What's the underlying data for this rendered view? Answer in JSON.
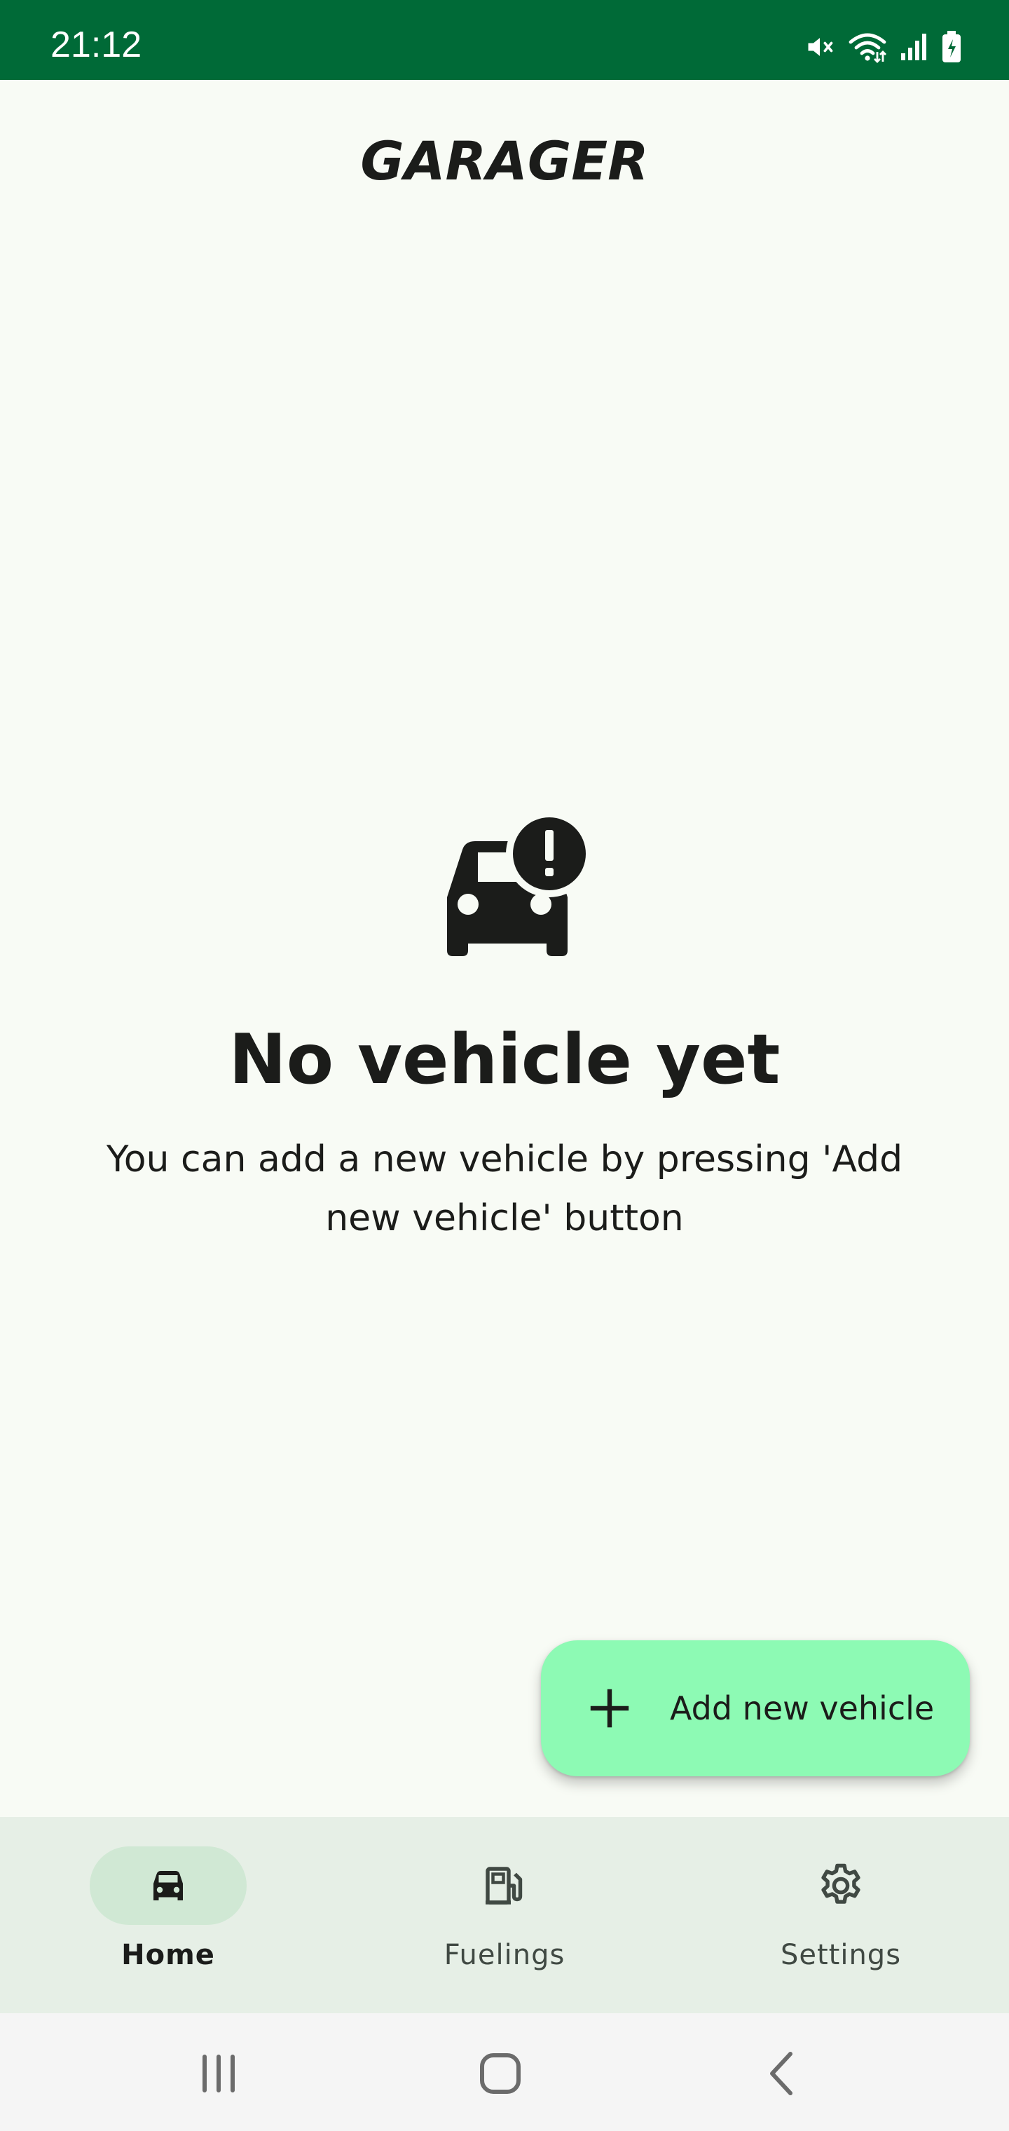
{
  "status_bar": {
    "time": "21:12",
    "icons": [
      "mute-icon",
      "wifi-icon",
      "signal-icon",
      "battery-charging-icon"
    ],
    "background": "#006a37"
  },
  "app_bar": {
    "title": "GARAGER"
  },
  "empty_state": {
    "icon": "car-alert-icon",
    "title": "No vehicle yet",
    "description": "You can add a new vehicle by pressing 'Add new vehicle' button"
  },
  "fab": {
    "icon": "plus-icon",
    "label": "Add new vehicle",
    "color": "#8dfab4"
  },
  "bottom_nav": {
    "items": [
      {
        "label": "Home",
        "icon": "car-icon",
        "selected": true
      },
      {
        "label": "Fuelings",
        "icon": "fuel-pump-icon",
        "selected": false
      },
      {
        "label": "Settings",
        "icon": "gear-icon",
        "selected": false
      }
    ],
    "background": "#e6efe6",
    "indicator_color": "#d0e8d4"
  },
  "system_nav": {
    "buttons": [
      "recents-icon",
      "home-icon",
      "back-icon"
    ]
  }
}
